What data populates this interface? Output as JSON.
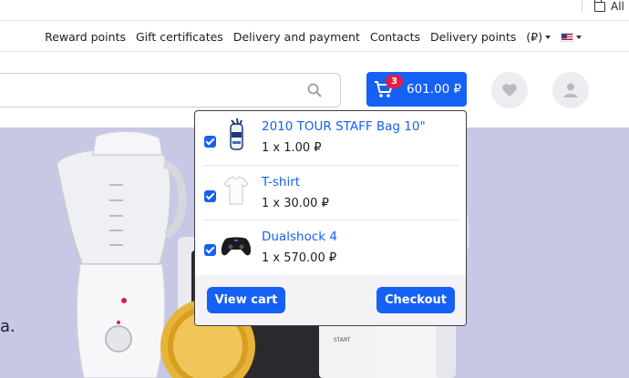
{
  "top_strip": {
    "all_label": "All"
  },
  "nav": {
    "links": [
      "Reward points",
      "Gift certificates",
      "Delivery and payment",
      "Contacts",
      "Delivery points"
    ],
    "currency": "(₽)",
    "language_flag": "us-flag-icon"
  },
  "search": {
    "placeholder": "",
    "icon": "search-icon"
  },
  "cart": {
    "count": "3",
    "total": "601.00 ₽",
    "icon": "cart-icon"
  },
  "header_icons": [
    "heart-icon",
    "user-icon"
  ],
  "hero": {
    "text_fragment": "a."
  },
  "cart_dropdown": {
    "items": [
      {
        "name": "2010 TOUR STAFF Bag 10\"",
        "qty": "1 x 1.00 ₽",
        "checked": true,
        "thumb": "golf-bag-icon"
      },
      {
        "name": "T-shirt",
        "qty": "1 x 30.00 ₽",
        "checked": true,
        "thumb": "tshirt-icon"
      },
      {
        "name": "Dualshock 4",
        "qty": "1 x 570.00 ₽",
        "checked": true,
        "thumb": "gamepad-icon"
      }
    ],
    "view_cart_label": "View cart",
    "checkout_label": "Checkout"
  },
  "colors": {
    "primary": "#1560f5",
    "badge": "#e11d48",
    "hero_bg": "#c7c7e6"
  }
}
